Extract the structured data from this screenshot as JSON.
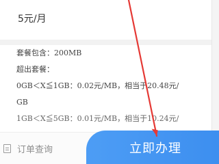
{
  "price": {
    "text": "5元/月"
  },
  "details": {
    "line1": "套餐包含：200MB",
    "line2": "超出套餐：",
    "line3": "0GB＜X≦1GB：0.02元/MB，相当于20.48元/",
    "line4": "GB",
    "line5": "1GB＜X≦5GB：0.01元/MB，相当于10.24元/"
  },
  "bottom": {
    "order_query": "订单查询",
    "apply_now": "立即办理"
  },
  "colors": {
    "primary_button": "#3d8ff0",
    "annotation_arrow": "#e53935"
  },
  "icons": {
    "order_query": "document-icon"
  }
}
